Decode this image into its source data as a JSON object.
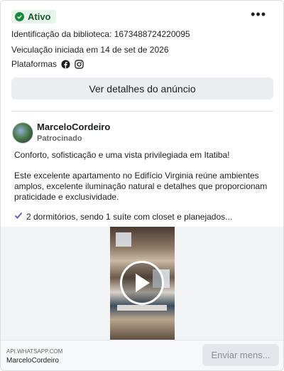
{
  "status": {
    "label": "Ativo",
    "icon": "check-circle-icon",
    "color": "#1a8b3c"
  },
  "menu": {
    "icon": "more-icon",
    "label": "•••"
  },
  "library_id": "Identificação da biblioteca: 1673488724220095",
  "start_date": "Veiculação iniciada em 14 de set de 2026",
  "platforms": {
    "label": "Plataformas",
    "icons": [
      "facebook-icon",
      "instagram-icon"
    ]
  },
  "details_button": "Ver detalhes do anúncio",
  "advertiser": {
    "name": "MarceloCordeiro",
    "sponsored": "Patrocinado"
  },
  "ad_text": {
    "headline": "Conforto, sofisticação e uma vista privilegiada em Itatiba!",
    "body": "Este excelente apartamento no Edifício Virginia reúne ambientes amplos, excelente iluminação natural e detalhes que proporcionam praticidade e exclusividade.",
    "check_item": "2 dormitórios, sendo 1 suíte com closet e planejados..."
  },
  "media": {
    "type": "video",
    "play_icon": "play-icon"
  },
  "footer": {
    "domain": "API.WHATSAPP.COM",
    "name": "MarceloCordeiro",
    "cta": "Enviar mens..."
  }
}
